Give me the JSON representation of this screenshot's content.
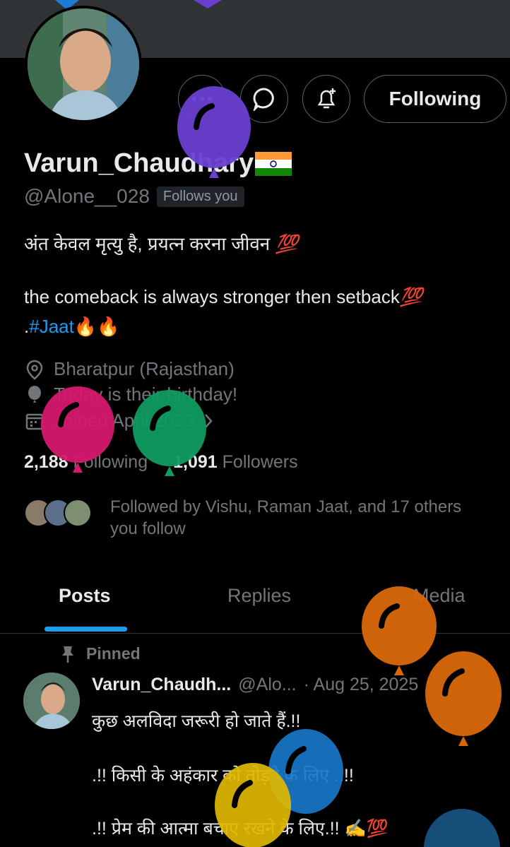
{
  "profile": {
    "display_name": "Varun_Chaudhary",
    "flag_emoji": "🇮🇳",
    "handle": "@Alone__028",
    "follows_you_badge": "Follows you",
    "bio_line1": "अंत केवल मृत्यु है, प्रयत्न करना जीवन",
    "bio_line1_emoji": "💯",
    "bio_line2": "the comeback is always stronger then setback",
    "bio_line2_emoji": "💯",
    "bio_line3_prefix": ".",
    "bio_hashtag": "#Jaat",
    "bio_line3_emoji": "🔥🔥",
    "location": "Bharatpur (Rajasthan)",
    "birthday": "Today is their birthday!",
    "joined": "Joined April 2023",
    "following_count": "2,188",
    "following_label": "Following",
    "followers_count": "1,091",
    "followers_label": "Followers",
    "followed_by_text": "Followed by Vishu, Raman Jaat, and 17 others you follow"
  },
  "actions": {
    "more_icon": "more-dots-icon",
    "message_icon": "message-icon",
    "notify_icon": "bell-plus-icon",
    "follow_label": "Following"
  },
  "tabs": [
    {
      "label": "Posts",
      "active": true
    },
    {
      "label": "Replies",
      "active": false
    },
    {
      "label": "Media",
      "active": false
    }
  ],
  "pinned_post": {
    "pinned_label": "Pinned",
    "author_name": "Varun_Chaudh...",
    "author_handle": "@Alo...",
    "date": "· Aug 25, 2025",
    "more": "···",
    "lines": [
      "कुछ अलविदा जरूरी हो जाते हैं.!!",
      ".!! किसी के अहंकार को तोड़ने के लिए ..!!",
      ".!! प्रेम की आत्मा बचाए रखने के लिए.!! ✍️💯"
    ]
  },
  "colors": {
    "accent": "#1d9bf0",
    "balloon_purple": "#6a3fd0",
    "balloon_pink": "#d6186e",
    "balloon_green": "#0f9b62",
    "balloon_orange": "#d9680a",
    "balloon_blue": "#1877c9",
    "balloon_yellow": "#e0b800"
  }
}
